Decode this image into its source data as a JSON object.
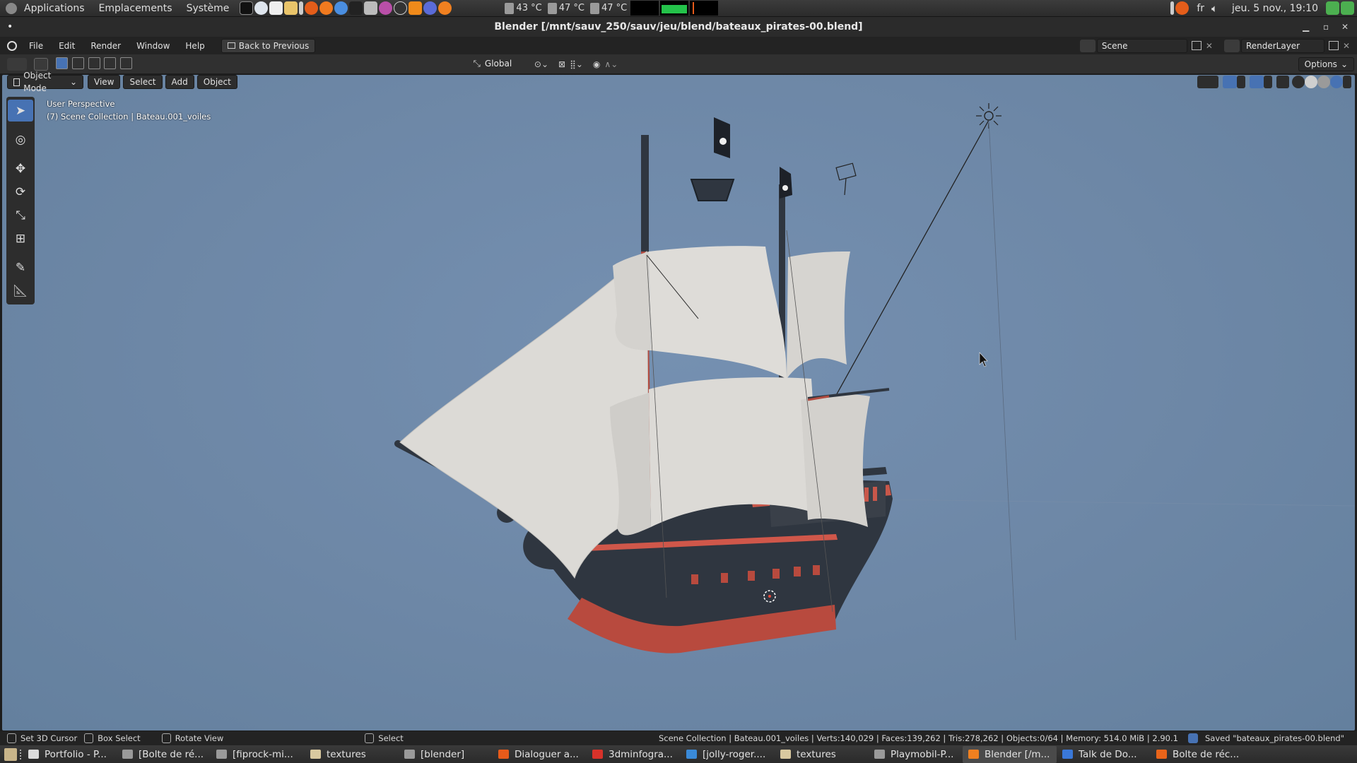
{
  "system_panel": {
    "menus": [
      "Applications",
      "Emplacements",
      "Système"
    ],
    "temps": [
      "43 °C",
      "47 °C",
      "47 °C"
    ],
    "lang": "fr",
    "clock": "jeu. 5 nov., 19:10"
  },
  "window": {
    "title": "Blender [/mnt/sauv_250/sauv/jeu/blend/bateaux_pirates-00.blend]"
  },
  "top_bar": {
    "menus": [
      "File",
      "Edit",
      "Render",
      "Window",
      "Help"
    ],
    "back_button": "Back to Previous",
    "scene": "Scene",
    "render_layer": "RenderLayer"
  },
  "tool_row": {
    "orientation": "Global",
    "options": "Options"
  },
  "viewport_header": {
    "mode": "Object Mode",
    "menus": [
      "View",
      "Select",
      "Add",
      "Object"
    ]
  },
  "viewport": {
    "perspective": "User Perspective",
    "collection": "(7) Scene Collection | Bateau.001_voiles"
  },
  "toolbar": {
    "tools": [
      "select-box",
      "cursor",
      "move",
      "rotate",
      "scale",
      "transform",
      "annotate",
      "measure"
    ],
    "active": "select-box"
  },
  "status_bar": {
    "left": [
      "Set 3D Cursor",
      "Box Select",
      "Rotate View",
      "Select"
    ],
    "stats": "Scene Collection | Bateau.001_voiles | Verts:140,029 | Faces:139,262 | Tris:278,262 | Objects:0/64 | Memory: 514.0 MiB | 2.90.1",
    "message": "Saved \"bateaux_pirates-00.blend\""
  },
  "taskbar": {
    "items": [
      {
        "label": "Portfolio - P...",
        "color": "#dcdcdc"
      },
      {
        "label": "[Bolte de ré...",
        "color": "#9a9a9a"
      },
      {
        "label": "[fiprock-mi...",
        "color": "#9a9a9a"
      },
      {
        "label": "textures",
        "color": "#d9c9a0"
      },
      {
        "label": "[blender]",
        "color": "#9a9a9a"
      },
      {
        "label": "Dialoguer a...",
        "color": "#e85b1a"
      },
      {
        "label": "3dminfogra...",
        "color": "#d8322a"
      },
      {
        "label": "[jolly-roger....",
        "color": "#3a8ad8"
      },
      {
        "label": "textures",
        "color": "#d9c9a0"
      },
      {
        "label": "Playmobil-P...",
        "color": "#9a9a9a"
      },
      {
        "label": "Blender [/m...",
        "color": "#f08020"
      },
      {
        "label": "Talk de Do...",
        "color": "#3a78d8"
      },
      {
        "label": "Bolte de réc...",
        "color": "#e8641a"
      }
    ],
    "active_index": 10
  },
  "colors": {
    "accent": "#4772b3",
    "sky": "#7590b1",
    "hull": "#2f3640",
    "hull_trim": "#c04a3e",
    "sail": "#dcdad6"
  }
}
